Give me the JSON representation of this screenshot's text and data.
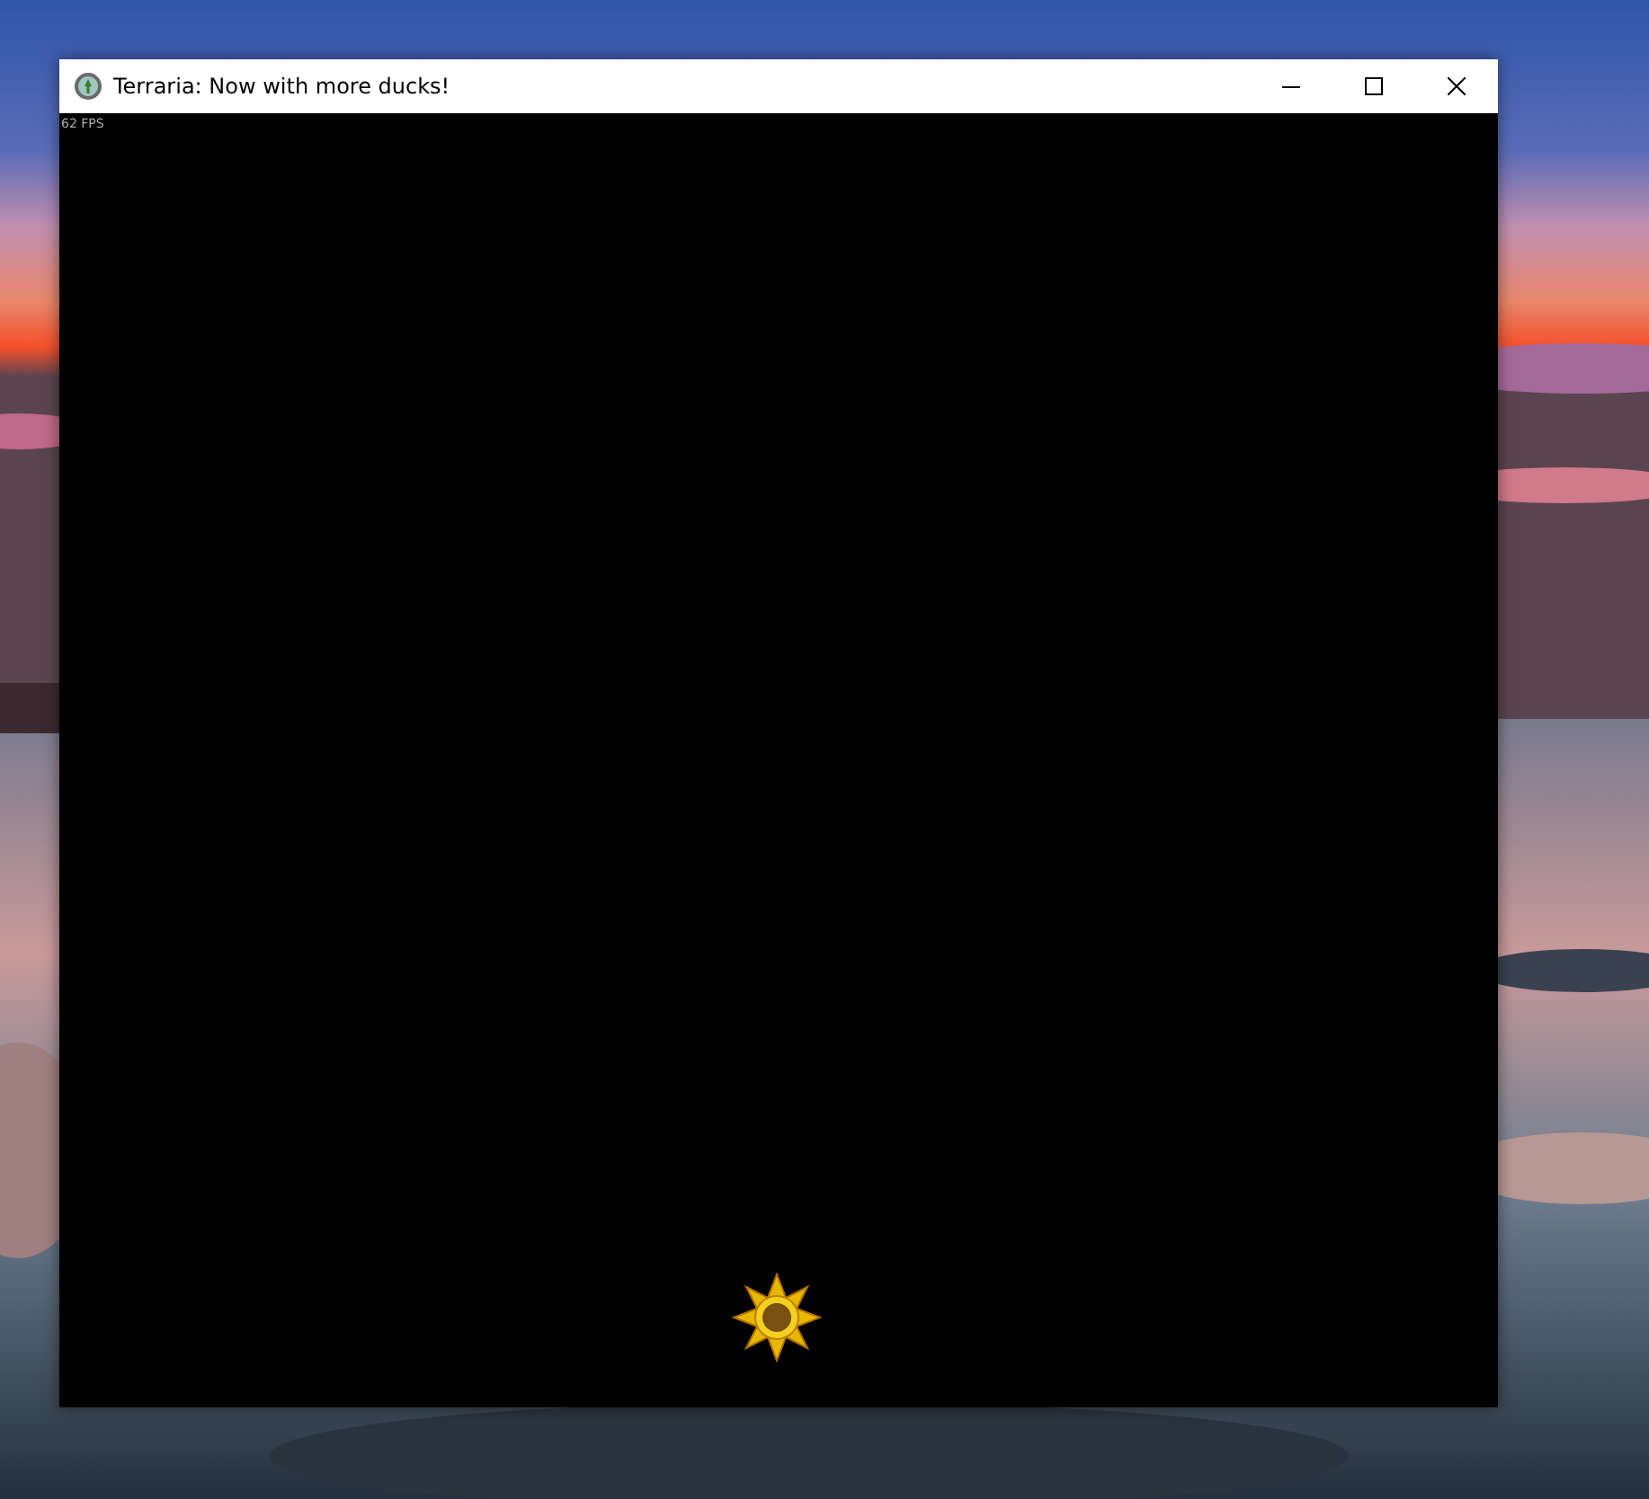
{
  "window": {
    "title": "Terraria: Now with more ducks!"
  },
  "game": {
    "fps": "62 FPS"
  }
}
